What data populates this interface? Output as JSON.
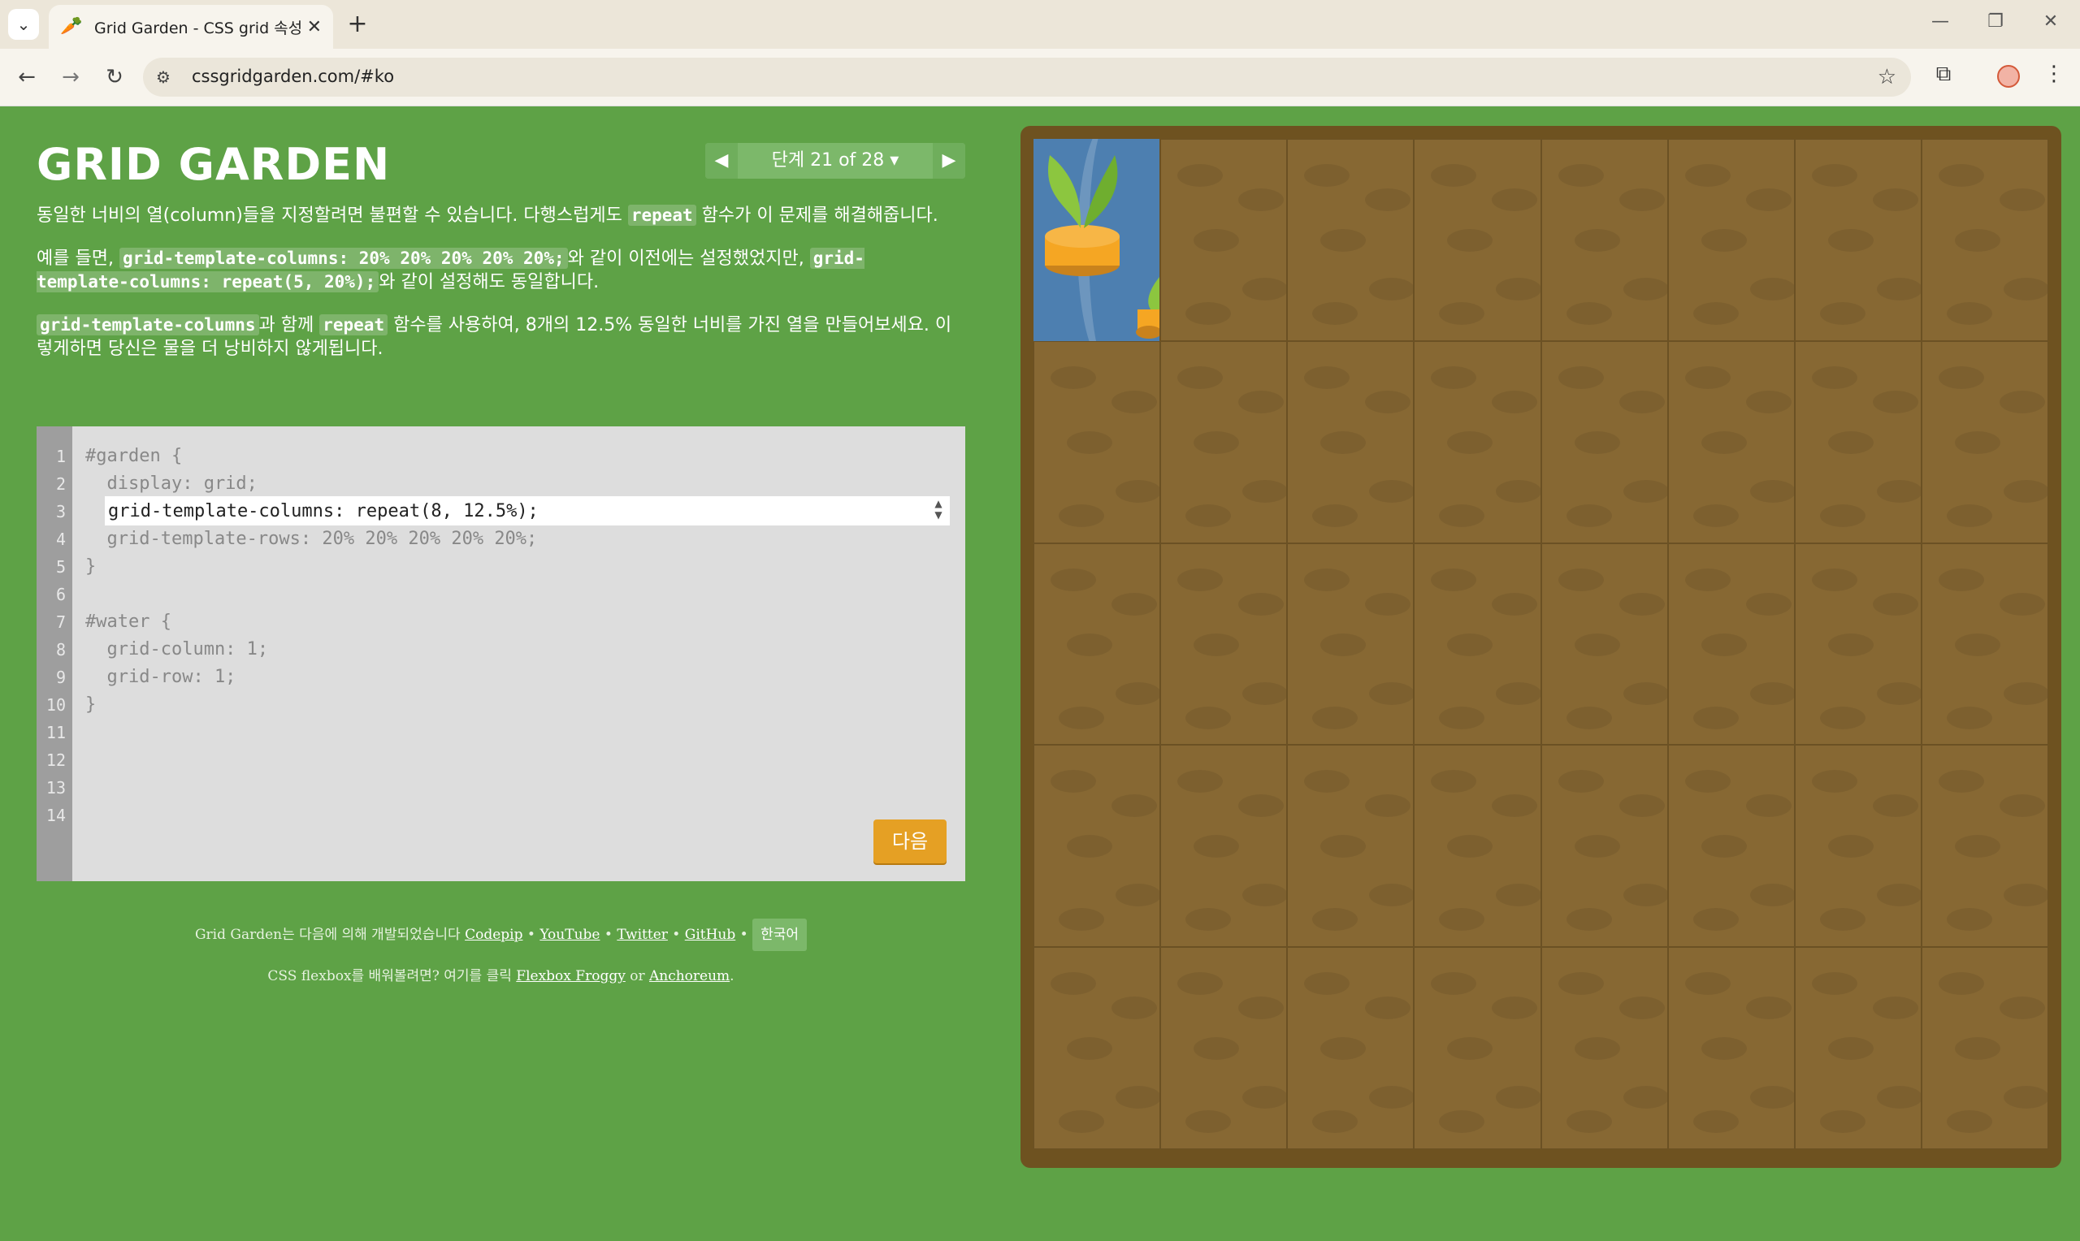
{
  "browser": {
    "tab_title": "Grid Garden - CSS grid 속성 배",
    "url": "cssgridgarden.com/#ko",
    "new_tab_label": "+"
  },
  "header": {
    "logo": "GRID GARDEN",
    "level_indicator": "단계 21 of 28 ▾"
  },
  "instructions": {
    "p1_before": "동일한 너비의 열(column)들을 지정할려면 불편할 수 있습니다. 다행스럽게도 ",
    "p1_code": "repeat",
    "p1_after": " 함수가 이 문제를 해결해줍니다.",
    "p2_before": "예를 들면, ",
    "p2_code1": "grid-template-columns: 20% 20% 20% 20% 20%;",
    "p2_mid": "와 같이 이전에는 설정했었지만, ",
    "p2_code2": "grid-template-columns: repeat(5, 20%);",
    "p2_after": "와 같이 설정해도 동일합니다.",
    "p3_code1": "grid-template-columns",
    "p3_mid": "과 함께 ",
    "p3_code2": "repeat",
    "p3_after": " 함수를 사용하여, 8개의 12.5% 동일한 너비를 가진 열을 만들어보세요. 이렇게하면 당신은 물을 더 낭비하지 않게됩니다."
  },
  "editor": {
    "line_numbers": [
      "1",
      "2",
      "3",
      "4",
      "5",
      "6",
      "7",
      "8",
      "9",
      "10",
      "11",
      "12",
      "13",
      "14"
    ],
    "lines": [
      "#garden {",
      "  display: grid;",
      "",
      "  grid-template-rows: 20% 20% 20% 20% 20%;",
      "}",
      "",
      "#water {",
      "  grid-column: 1;",
      "  grid-row: 1;",
      "}",
      "",
      "",
      "",
      ""
    ],
    "input_value": "grid-template-columns: repeat(8, 12.5%);",
    "next_button": "다음"
  },
  "footer": {
    "credit_text": "Grid Garden는 다음에 의해 개발되었습니다 ",
    "links": [
      "Codepip",
      "YouTube",
      "Twitter",
      "GitHub"
    ],
    "separator": " • ",
    "language": "한국어",
    "learn_text": "CSS flexbox를 배워볼려면? 여기를 클릭 ",
    "learn_link1": "Flexbox Froggy",
    "learn_or": " or ",
    "learn_link2": "Anchoreum",
    "learn_end": "."
  },
  "garden": {
    "columns": 8,
    "rows": 5
  },
  "colors": {
    "background": "#5ea246",
    "soil": "#876833",
    "water": "#4d7fb0",
    "button": "#e5a024"
  }
}
